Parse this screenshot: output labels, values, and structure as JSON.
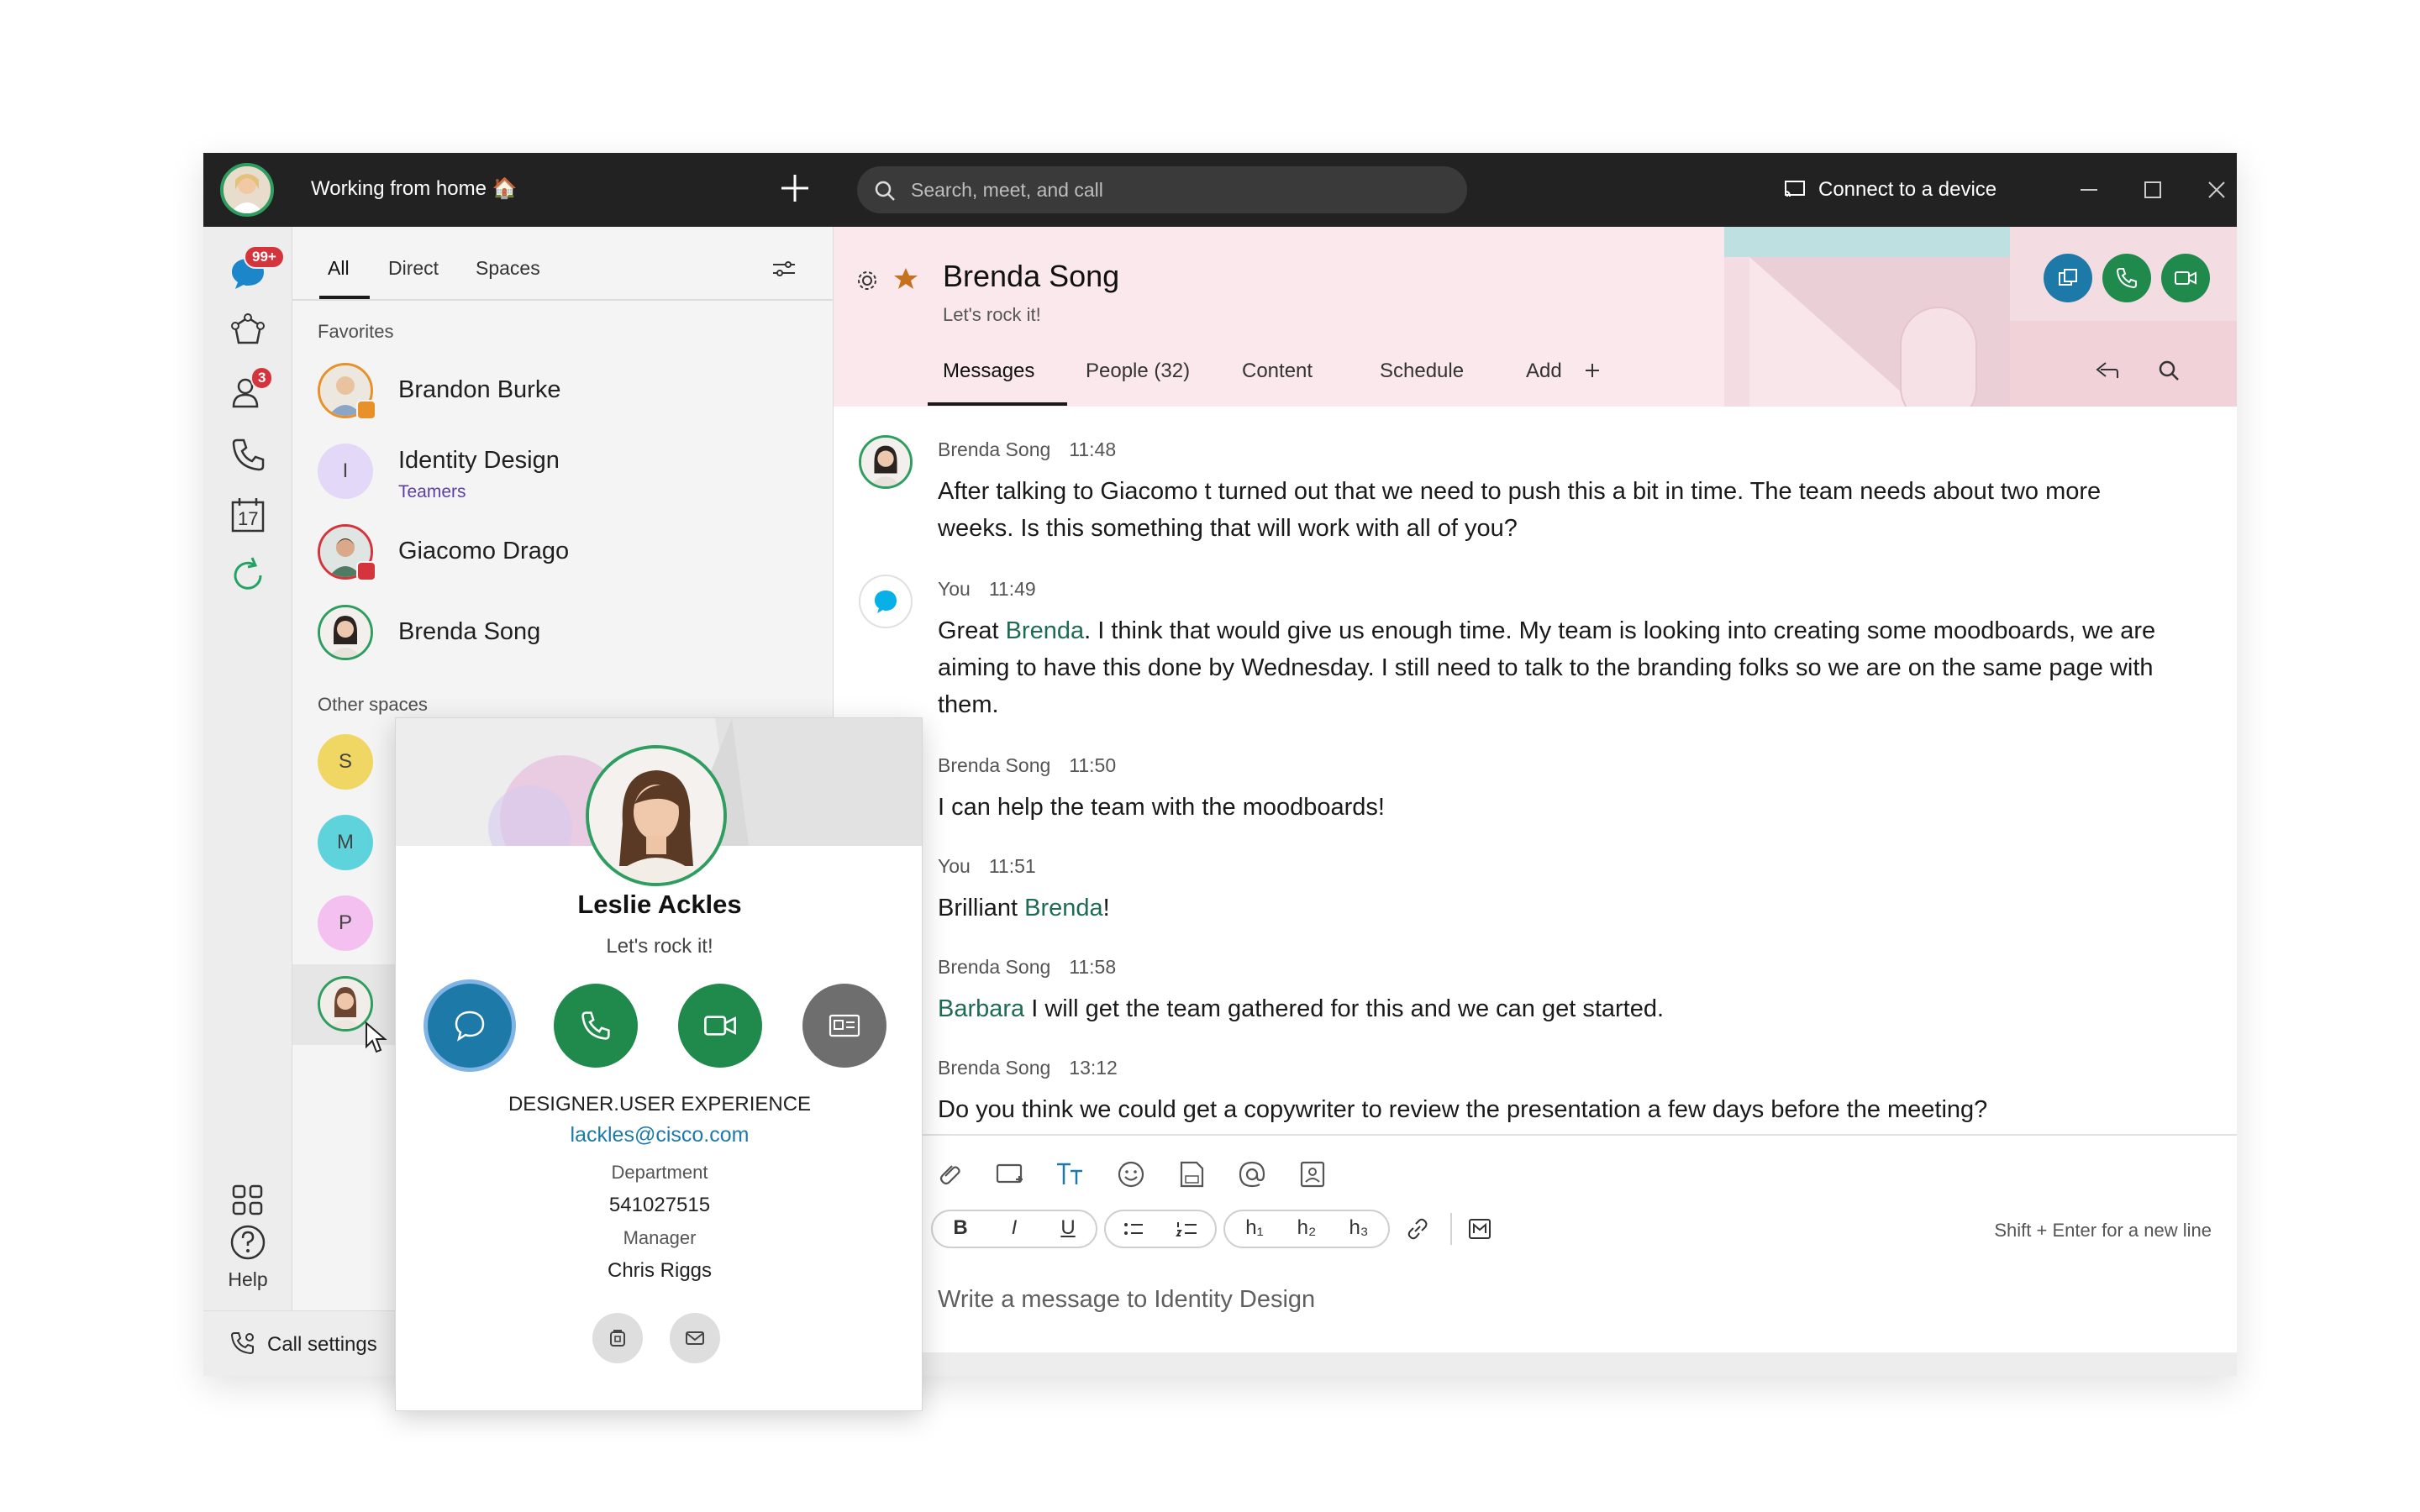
{
  "titlebar": {
    "status": "Working from home 🏠",
    "search_placeholder": "Search, meet, and call",
    "connect_label": "Connect to a device"
  },
  "rail": {
    "messaging_badge": "99+",
    "contacts_badge": "3",
    "calendar_day": "17",
    "help_label": "Help"
  },
  "list": {
    "filters": [
      "All",
      "Direct",
      "Spaces"
    ],
    "favorites_label": "Favorites",
    "favorites": [
      {
        "name": "Brandon Burke"
      },
      {
        "name": "Identity Design",
        "sub": "Teamers",
        "initial": "I"
      },
      {
        "name": "Giacomo Drago"
      },
      {
        "name": "Brenda Song"
      }
    ],
    "other_label": "Other spaces",
    "others": [
      {
        "initial": "S",
        "color": "#f0d662"
      },
      {
        "initial": "M",
        "color": "#5ed3dc"
      },
      {
        "initial": "P",
        "color": "#f4c0f0"
      }
    ],
    "call_settings": "Call settings"
  },
  "header": {
    "title": "Brenda Song",
    "subtitle": "Let's rock it!",
    "tabs": [
      "Messages",
      "People (32)",
      "Content",
      "Schedule",
      "Add"
    ]
  },
  "messages": [
    {
      "author": "Brenda Song",
      "time": "11:48",
      "text": "After talking to Giacomo t turned out that we need to push this a bit in time. The team needs about two more weeks. Is this something that will work with all of you?"
    },
    {
      "author": "You",
      "time": "11:49",
      "pre": "Great ",
      "mention": "Brenda",
      "text": ". I think that would give us enough time. My team is looking into creating some moodboards, we are aiming to have this done by Wednesday. I still need to talk to the branding folks so we are on the same page with them."
    },
    {
      "author": "Brenda Song",
      "time": "11:50",
      "text": "I can help the team with the moodboards!"
    },
    {
      "author": "You",
      "time": "11:51",
      "pre": "Brilliant ",
      "mention": "Brenda",
      "text": "!"
    },
    {
      "author": "Brenda Song",
      "time": "11:58",
      "mention": "Barbara",
      "text": " I will get the team gathered for this and we can get started."
    },
    {
      "author": "Brenda Song",
      "time": "13:12",
      "text": "Do you think we could get a copywriter to review the presentation a few days before the meeting?"
    }
  ],
  "composer": {
    "hint": "Shift + Enter for a new line",
    "placeholder": "Write a message to Identity Design",
    "bold": "B",
    "italic": "I",
    "underline": "U",
    "h1": "h₁",
    "h2": "h₂",
    "h3": "h₃"
  },
  "card": {
    "name": "Leslie Ackles",
    "status": "Let's rock it!",
    "title": "DESIGNER.USER EXPERIENCE",
    "email": "lackles@cisco.com",
    "department_label": "Department",
    "department_value": "541027515",
    "manager_label": "Manager",
    "manager_value": "Chris Riggs"
  },
  "colors": {
    "titlebar": "#222222",
    "accent_green": "#1f8a4c",
    "accent_blue": "#1d7aa8",
    "header_pink": "#fbe8ec",
    "badge_red": "#d4343b"
  }
}
